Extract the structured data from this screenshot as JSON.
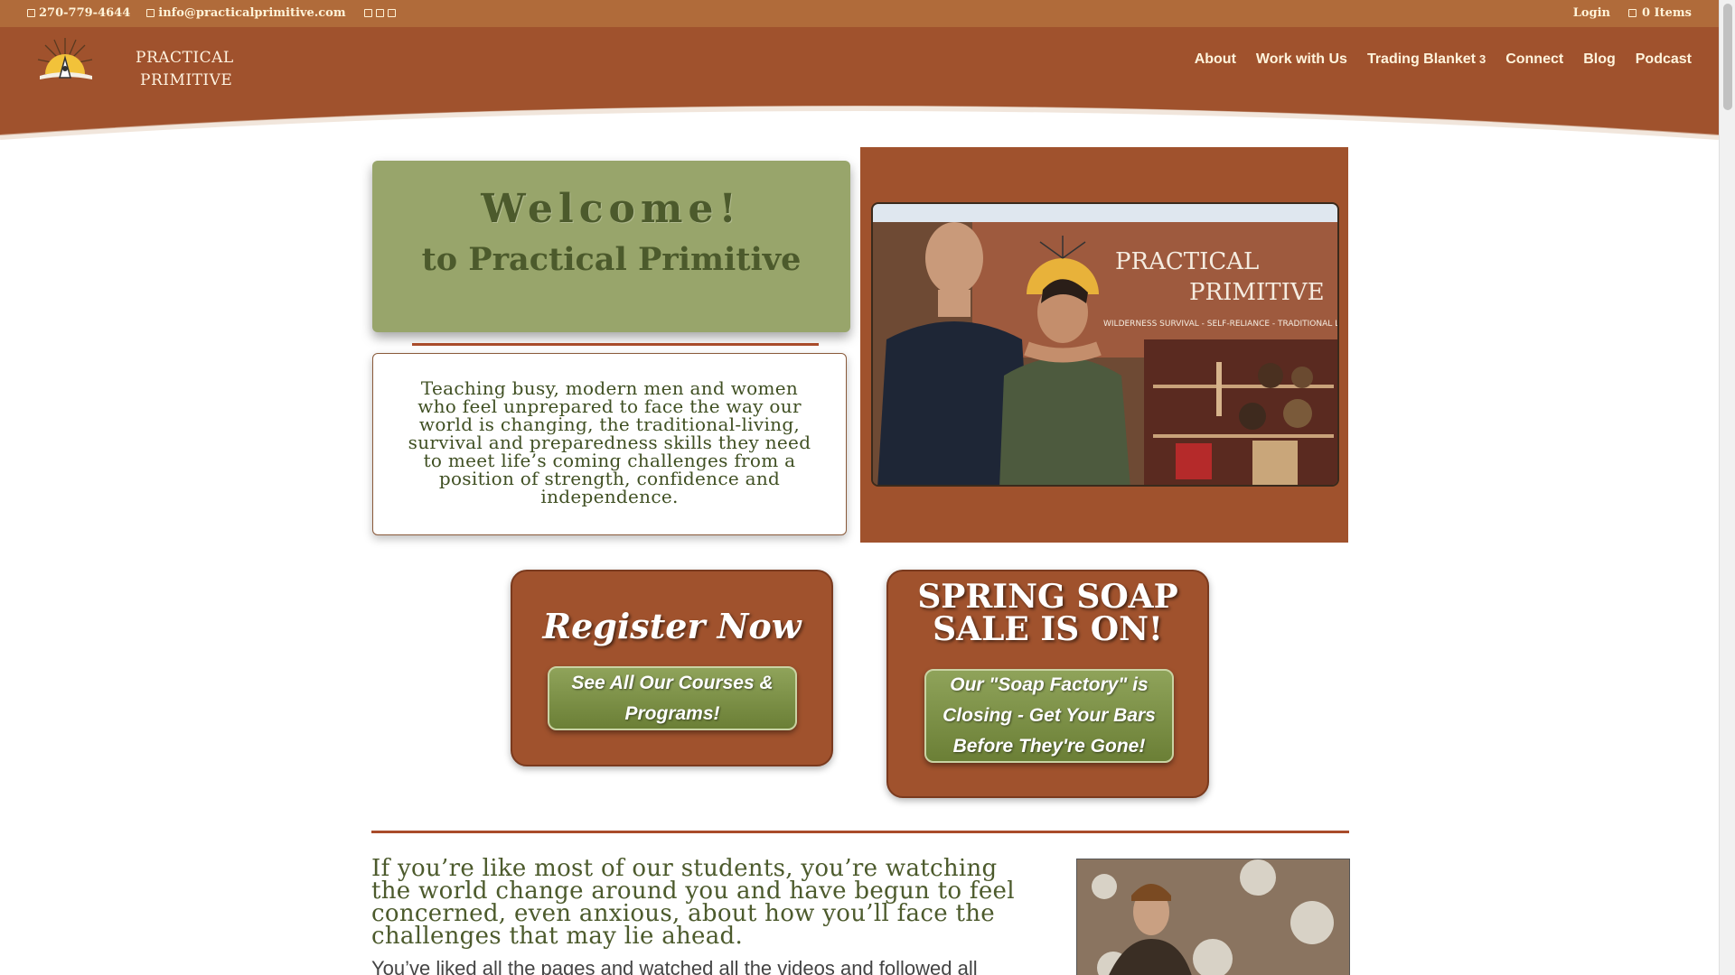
{
  "topbar": {
    "phone": "270-779-4644",
    "email": "info@practicalprimitive.com",
    "login": "Login",
    "cart": "0 Items"
  },
  "logo": {
    "line1": "PRACTICAL",
    "line2": "PRIMITIVE"
  },
  "nav": {
    "items": [
      "About",
      "Work with Us",
      "Trading Blanket",
      "Connect",
      "Blog",
      "Podcast"
    ],
    "dropdown_badge": "3"
  },
  "welcome": {
    "title": "Welcome!",
    "subtitle": "to Practical Primitive"
  },
  "intro": "Teaching busy, modern men and women who feel unprepared to face the way our world is changing, the traditional-living, survival and preparedness skills they need to meet life’s coming challenges from a position of strength, confidence and independence.",
  "photo": {
    "banner_line1": "PRACTICAL",
    "banner_line2": "PRIMITIVE",
    "banner_tagline": "WILDERNESS SURVIVAL - SELF-RELIANCE - TRADITIONAL LIVING"
  },
  "register": {
    "heading": "Register Now",
    "button": "See All Our Courses & Programs!"
  },
  "soap": {
    "heading_line1": "SPRING SOAP",
    "heading_line2": "SALE IS ON!",
    "button": "Our \"Soap Factory\" is Closing - Get Your Bars Before They're Gone!"
  },
  "lead": "If you’re like most of our students, you’re watching the world change around you and have begun to feel concerned, even anxious, about how you’ll face the challenges that may lie ahead.",
  "body_text": "You’ve liked all the pages and watched all the videos and followed all",
  "colors": {
    "brand_brown": "#a0522d",
    "topbar": "#b06b3a",
    "olive": "#98a56b",
    "text_green": "#4c5a2c"
  }
}
